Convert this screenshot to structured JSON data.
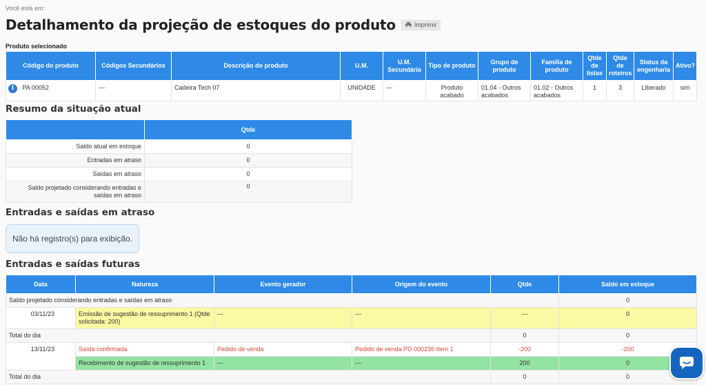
{
  "breadcrumb": "Você está em:",
  "page_title": "Detalhamento da projeção de estoques do produto",
  "print_label": "Imprimir",
  "selected_label": "Produto selecionado",
  "product_table": {
    "headers": [
      "Código do produto",
      "Códigos Secundários",
      "Descrição do produto",
      "U.M.",
      "U.M. Secundária",
      "Tipo de produto",
      "Grupo de produto",
      "Família de produto",
      "Qtde de listas",
      "Qtde de roteiros",
      "Status da engenharia",
      "Ativo?"
    ],
    "row": [
      "PA 00052",
      "---",
      "Cadeira Tech 07",
      "UNIDADE",
      "---",
      "Produto acabado",
      "01.04 - Outros acabados",
      "01.02 - Outros acabados",
      "1",
      "3",
      "Liberado",
      "sim"
    ]
  },
  "resumo": {
    "title": "Resumo da situação atual",
    "header": "Qtde",
    "rows": [
      {
        "label": "Saldo atual em estoque",
        "value": "0"
      },
      {
        "label": "Entradas em atraso",
        "value": "0"
      },
      {
        "label": "Saídas em atraso",
        "value": "0"
      },
      {
        "label": "Saldo projetado considerando entradas e saídas em atraso",
        "value": "0"
      }
    ]
  },
  "atraso": {
    "title": "Entradas e saídas em atraso",
    "empty_message": "Não há registro(s) para exibição."
  },
  "futuras": {
    "title": "Entradas e saídas futuras",
    "headers": [
      "Data",
      "Natureza",
      "Evento gerador",
      "Origem do evento",
      "Qtde",
      "Saldo em estoque"
    ],
    "projected_label": "Saldo projetado considerando entradas e saídas em atraso",
    "projected_value": "0",
    "day1": {
      "date": "03/11/23",
      "natureza": "Emissão de sugestão de ressuprimento 1 (Qtde solicitada: 200)",
      "evento": "---",
      "origem": "---",
      "qtde": "---",
      "saldo": "0"
    },
    "day1_total": {
      "label": "Total do dia",
      "qtde": "0",
      "saldo": "0"
    },
    "day2": {
      "date": "13/11/23",
      "row1": {
        "natureza": "Saída confirmada",
        "evento": "Pedido de venda",
        "origem": "Pedido de venda PD 000236 Item 1",
        "qtde": "-200",
        "saldo": "-200"
      },
      "row2": {
        "natureza": "Recebimento de sugestão de ressuprimento 1",
        "evento": "---",
        "origem": "---",
        "qtde": "200",
        "saldo": "0"
      }
    },
    "day2_total": {
      "label": "Total do dia",
      "qtde": "0",
      "saldo": "0"
    }
  },
  "colors": {
    "header_blue": "#2e8ae6",
    "highlight_yellow": "#fbf9a3",
    "highlight_green": "#93e3a3",
    "negative_red": "#d9453a",
    "chat_blue": "#1565c0"
  },
  "icons": [
    "print-icon",
    "info-icon",
    "chat-icon"
  ]
}
